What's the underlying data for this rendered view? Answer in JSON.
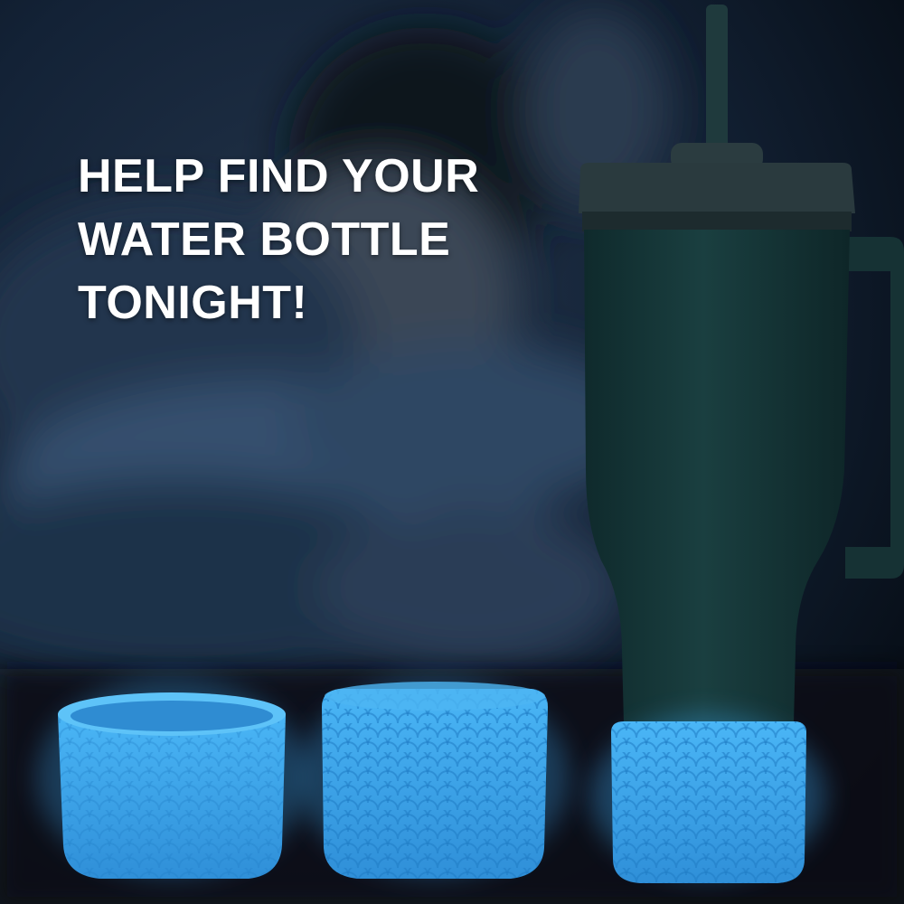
{
  "headline": {
    "lines": [
      "HELP FIND YOUR",
      "WATER BOTTLE",
      "TONIGHT!"
    ]
  },
  "colors": {
    "night_background": "#0d1a2a",
    "tumbler_body": "#153838",
    "tumbler_lid": "#2a3b3f",
    "glow_blue": "#3aa8f0",
    "headline_text": "#ffffff"
  },
  "scene": {
    "background": "blurred-person-sleeping-in-bed",
    "product": "tumbler-with-straw-and-handle",
    "boots": [
      "glow-boot-left",
      "glow-boot-middle",
      "glow-boot-on-tumbler"
    ]
  }
}
